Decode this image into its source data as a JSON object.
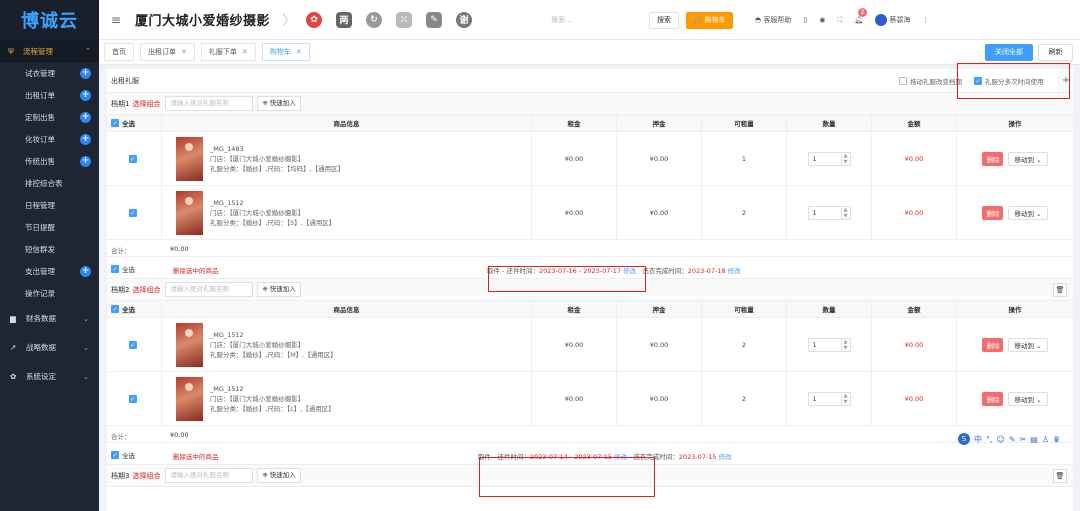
{
  "sidebar": {
    "logo": "博诚云",
    "group_label": "流程管理",
    "items": [
      {
        "label": "试衣管理",
        "plus": true
      },
      {
        "label": "出租订单",
        "plus": true
      },
      {
        "label": "定制出售",
        "plus": true
      },
      {
        "label": "化妆订单",
        "plus": true
      },
      {
        "label": "传统出售",
        "plus": true
      },
      {
        "label": "排控综合表",
        "plus": false
      },
      {
        "label": "日程管理",
        "plus": false
      },
      {
        "label": "节日提醒",
        "plus": false
      },
      {
        "label": "短信群发",
        "plus": false
      },
      {
        "label": "支出管理",
        "plus": true
      },
      {
        "label": "操作记录",
        "plus": false
      }
    ],
    "top_items": [
      {
        "label": "财务数据",
        "icon": "wallet-icon"
      },
      {
        "label": "战略数据",
        "icon": "trend-icon"
      },
      {
        "label": "系统设定",
        "icon": "gear-icon"
      }
    ]
  },
  "header": {
    "title": "厦门大城小爱婚纱摄影",
    "search_placeholder": "搜索...",
    "search_button": "搜索",
    "cart_button": "购物车",
    "help": "客服帮助",
    "notification_count": "2",
    "user": "蔡碧海"
  },
  "tabs": [
    {
      "label": "首页",
      "closable": false,
      "active": false
    },
    {
      "label": "出租订单",
      "closable": true,
      "active": false
    },
    {
      "label": "礼服下单",
      "closable": true,
      "active": false
    },
    {
      "label": "购物车",
      "closable": true,
      "active": true
    }
  ],
  "tab_actions": {
    "close_all": "关闭全部",
    "refresh": "刷新"
  },
  "section": {
    "title": "出租礼服",
    "opt_drag": "拖动礼服改变档期",
    "opt_multi": "礼服分多次时间使用"
  },
  "columns": {
    "select_all": "全选",
    "info": "商品信息",
    "rent": "租金",
    "deposit": "押金",
    "available": "可租量",
    "qty": "数量",
    "amount": "金额",
    "op": "操作"
  },
  "combos": [
    {
      "name": "档期1",
      "pick": "选择组合",
      "input_placeholder": "请输入绝对礼服名称",
      "quick_add": "快速加入",
      "rows": [
        {
          "code": "_MG_1483",
          "store": "门店：【厦门大城小爱婚纱摄影】",
          "cat": "礼服分类：【婚纱】,尺码：【均码】,【通用区】",
          "rent": "¥0.00",
          "deposit": "¥0.00",
          "available": "1",
          "qty": "1",
          "amount": "¥0.00"
        },
        {
          "code": "_MG_1512",
          "store": "门店：【厦门大城小爱婚纱摄影】",
          "cat": "礼服分类：【婚纱】,尺码：【S】,【通用区】",
          "rent": "¥0.00",
          "deposit": "¥0.00",
          "available": "2",
          "qty": "1",
          "amount": "¥0.00"
        }
      ],
      "sum_label": "合计：",
      "sum": "¥0.00",
      "delete_selected": "删除选中的商品",
      "pickup_label": "取件 - 还件时间：",
      "pickup": "2023-07-16 - 2023-07-17",
      "edit": "修改",
      "wash_label": "洗衣完成时间：",
      "wash": "2023-07-18",
      "edit2": "修改"
    },
    {
      "name": "档期2",
      "pick": "选择组合",
      "input_placeholder": "请输入绝对礼服名称",
      "quick_add": "快速加入",
      "rows": [
        {
          "code": "_MG_1512",
          "store": "门店：【厦门大城小爱婚纱摄影】",
          "cat": "礼服分类：【婚纱】,尺码：【M】,【通用区】",
          "rent": "¥0.00",
          "deposit": "¥0.00",
          "available": "2",
          "qty": "1",
          "amount": "¥0.00"
        },
        {
          "code": "_MG_1512",
          "store": "门店：【厦门大城小爱婚纱摄影】",
          "cat": "礼服分类：【婚纱】,尺码：【L】,【通用区】",
          "rent": "¥0.00",
          "deposit": "¥0.00",
          "available": "2",
          "qty": "1",
          "amount": "¥0.00"
        }
      ],
      "sum_label": "合计：",
      "sum": "¥0.00",
      "delete_selected": "删除选中的商品",
      "pickup_label": "取件 - 还件时间：",
      "pickup": "2023-07-14 - 2023-07-15",
      "edit": "修改",
      "wash_label": "洗衣完成时间：",
      "wash": "2023-07-15",
      "edit2": "修改"
    },
    {
      "name": "档期3",
      "pick": "选择组合",
      "input_placeholder": "请输入绝对礼服名称",
      "quick_add": "快速加入"
    }
  ],
  "row_actions": {
    "delete": "删除",
    "move": "移动到"
  },
  "ime_bar": "中"
}
